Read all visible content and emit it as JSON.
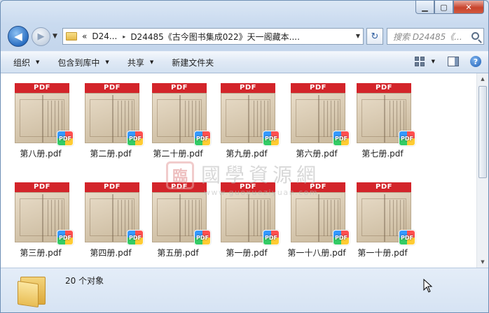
{
  "window": {
    "minimize_glyph": "▁",
    "maximize_glyph": "▢",
    "close_glyph": "✕"
  },
  "nav": {
    "back_glyph": "◀",
    "forward_glyph": "▶",
    "history_caret": "▼"
  },
  "address": {
    "overflow": "«",
    "segment_1": "D24...",
    "separator": "▸",
    "segment_2": "D24485《古今图书集成022》天一阁藏本....",
    "dropdown_caret": "▼"
  },
  "refresh_glyph": "↻",
  "search": {
    "placeholder": "搜索 D24485《..."
  },
  "toolbar": {
    "organize": "组织",
    "include_in_library": "包含到库中",
    "share": "共享",
    "new_folder": "新建文件夹",
    "caret": "▼",
    "help_glyph": "?"
  },
  "files": [
    {
      "name": "第八册.pdf",
      "badge": "PDF",
      "band": "PDF"
    },
    {
      "name": "第二册.pdf",
      "badge": "PDF",
      "band": "PDF"
    },
    {
      "name": "第二十册.pdf",
      "badge": "PDF",
      "band": "PDF"
    },
    {
      "name": "第九册.pdf",
      "badge": "PDF",
      "band": "PDF"
    },
    {
      "name": "第六册.pdf",
      "badge": "PDF",
      "band": "PDF"
    },
    {
      "name": "第七册.pdf",
      "badge": "PDF",
      "band": "PDF"
    },
    {
      "name": "第三册.pdf",
      "badge": "PDF",
      "band": "PDF"
    },
    {
      "name": "第四册.pdf",
      "badge": "PDF",
      "band": "PDF"
    },
    {
      "name": "第五册.pdf",
      "badge": "PDF",
      "band": "PDF"
    },
    {
      "name": "第一册.pdf",
      "badge": "PDF",
      "band": "PDF"
    },
    {
      "name": "第一十八册.pdf",
      "badge": "PDF",
      "band": "PDF"
    },
    {
      "name": "第一十册.pdf",
      "badge": "PDF",
      "band": "PDF"
    }
  ],
  "watermark": {
    "seal": "臨",
    "title": "國學資源網",
    "url": "www.guoxueziyuan.com"
  },
  "status": {
    "count_text": "20 个对象"
  },
  "scrollbar": {
    "up_glyph": "▲",
    "down_glyph": "▼"
  },
  "colors": {
    "pdf_band": "#d3242a",
    "toolbar_bg": "#dfe9f5",
    "window_frame": "#c9daef"
  }
}
